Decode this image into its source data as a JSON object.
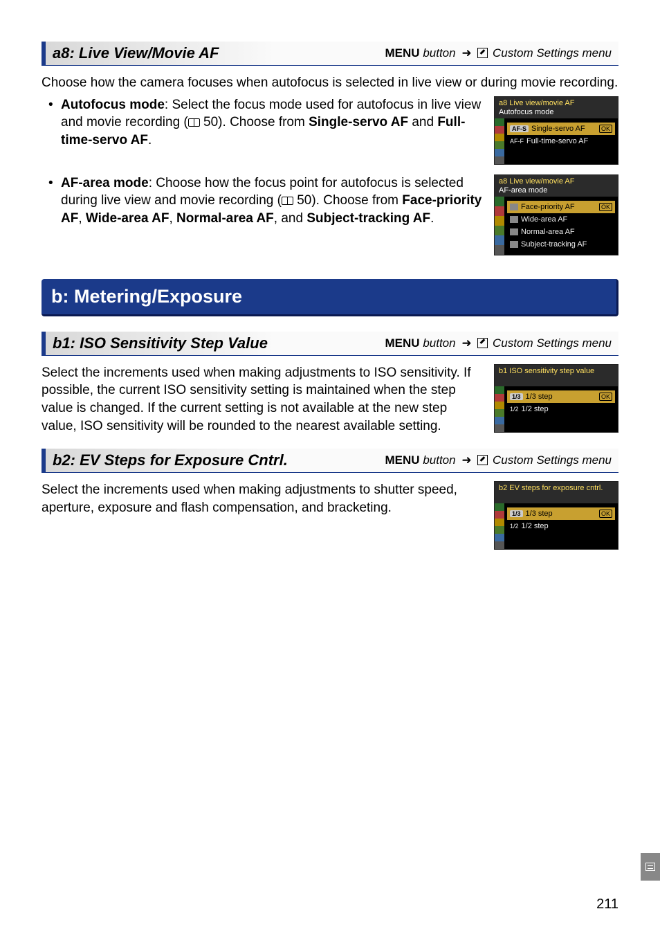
{
  "a8": {
    "title": "a8: Live View/Movie AF",
    "menu_button": "MENU",
    "menu_word": "button",
    "menu_dest": "Custom Settings menu",
    "intro": "Choose how the camera focuses when autofocus is selected in live view or during movie recording.",
    "bullet1_lead": "Autofocus mode",
    "bullet1_text1": ": Select the focus mode used for autofocus in live view and movie recording (",
    "bullet1_pageref": " 50).  Choose from ",
    "bullet1_bold1": "Single-servo AF",
    "bullet1_mid": " and ",
    "bullet1_bold2": "Full-time-servo AF",
    "bullet1_end": ".",
    "bullet2_lead": "AF-area mode",
    "bullet2_text1": ": Choose how the focus point for autofocus is selected during live view and movie recording (",
    "bullet2_pageref": " 50). Choose from ",
    "bullet2_bold1": "Face-priority AF",
    "bullet2_sep": ", ",
    "bullet2_bold2": "Wide-area AF",
    "bullet2_bold3": "Normal-area AF",
    "bullet2_mid": ", and ",
    "bullet2_bold4": "Subject-tracking AF",
    "bullet2_end": ".",
    "cam1_title": "a8 Live view/movie AF",
    "cam1_sub": "Autofocus mode",
    "cam1_opt1_tag": "AF-S",
    "cam1_opt1": "Single-servo AF",
    "cam1_ok": "OK",
    "cam1_opt2_tag": "AF-F",
    "cam1_opt2": "Full-time-servo AF",
    "cam2_title": "a8 Live view/movie AF",
    "cam2_sub": "AF-area mode",
    "cam2_opt1": "Face-priority AF",
    "cam2_opt2": "Wide-area AF",
    "cam2_opt3": "Normal-area AF",
    "cam2_opt4": "Subject-tracking AF",
    "cam2_ok": "OK"
  },
  "b_heading": "b: Metering/Exposure",
  "b1": {
    "title": "b1: ISO Sensitivity Step Value",
    "menu_button": "MENU",
    "menu_word": "button",
    "menu_dest": "Custom Settings menu",
    "body": "Select the increments used when making adjustments to ISO sensitivity.  If possible, the current ISO sensitivity setting is maintained when the step value is changed.  If the current setting is not available at the new step value, ISO sensitivity will be rounded to the nearest available setting.",
    "cam_title": "b1 ISO sensitivity step value",
    "cam_opt1_tag": "1/3",
    "cam_opt1": "1/3 step",
    "cam_ok": "OK",
    "cam_opt2_tag": "1/2",
    "cam_opt2": "1/2 step"
  },
  "b2": {
    "title": "b2: EV Steps for Exposure Cntrl.",
    "menu_button": "MENU",
    "menu_word": "button",
    "menu_dest": "Custom Settings menu",
    "body": "Select the increments used when making adjustments to shutter speed, aperture, exposure and flash compensation, and bracketing.",
    "cam_title": "b2 EV steps for exposure cntrl.",
    "cam_opt1_tag": "1/3",
    "cam_opt1": "1/3 step",
    "cam_ok": "OK",
    "cam_opt2_tag": "1/2",
    "cam_opt2": "1/2 step"
  },
  "page_number": "211"
}
